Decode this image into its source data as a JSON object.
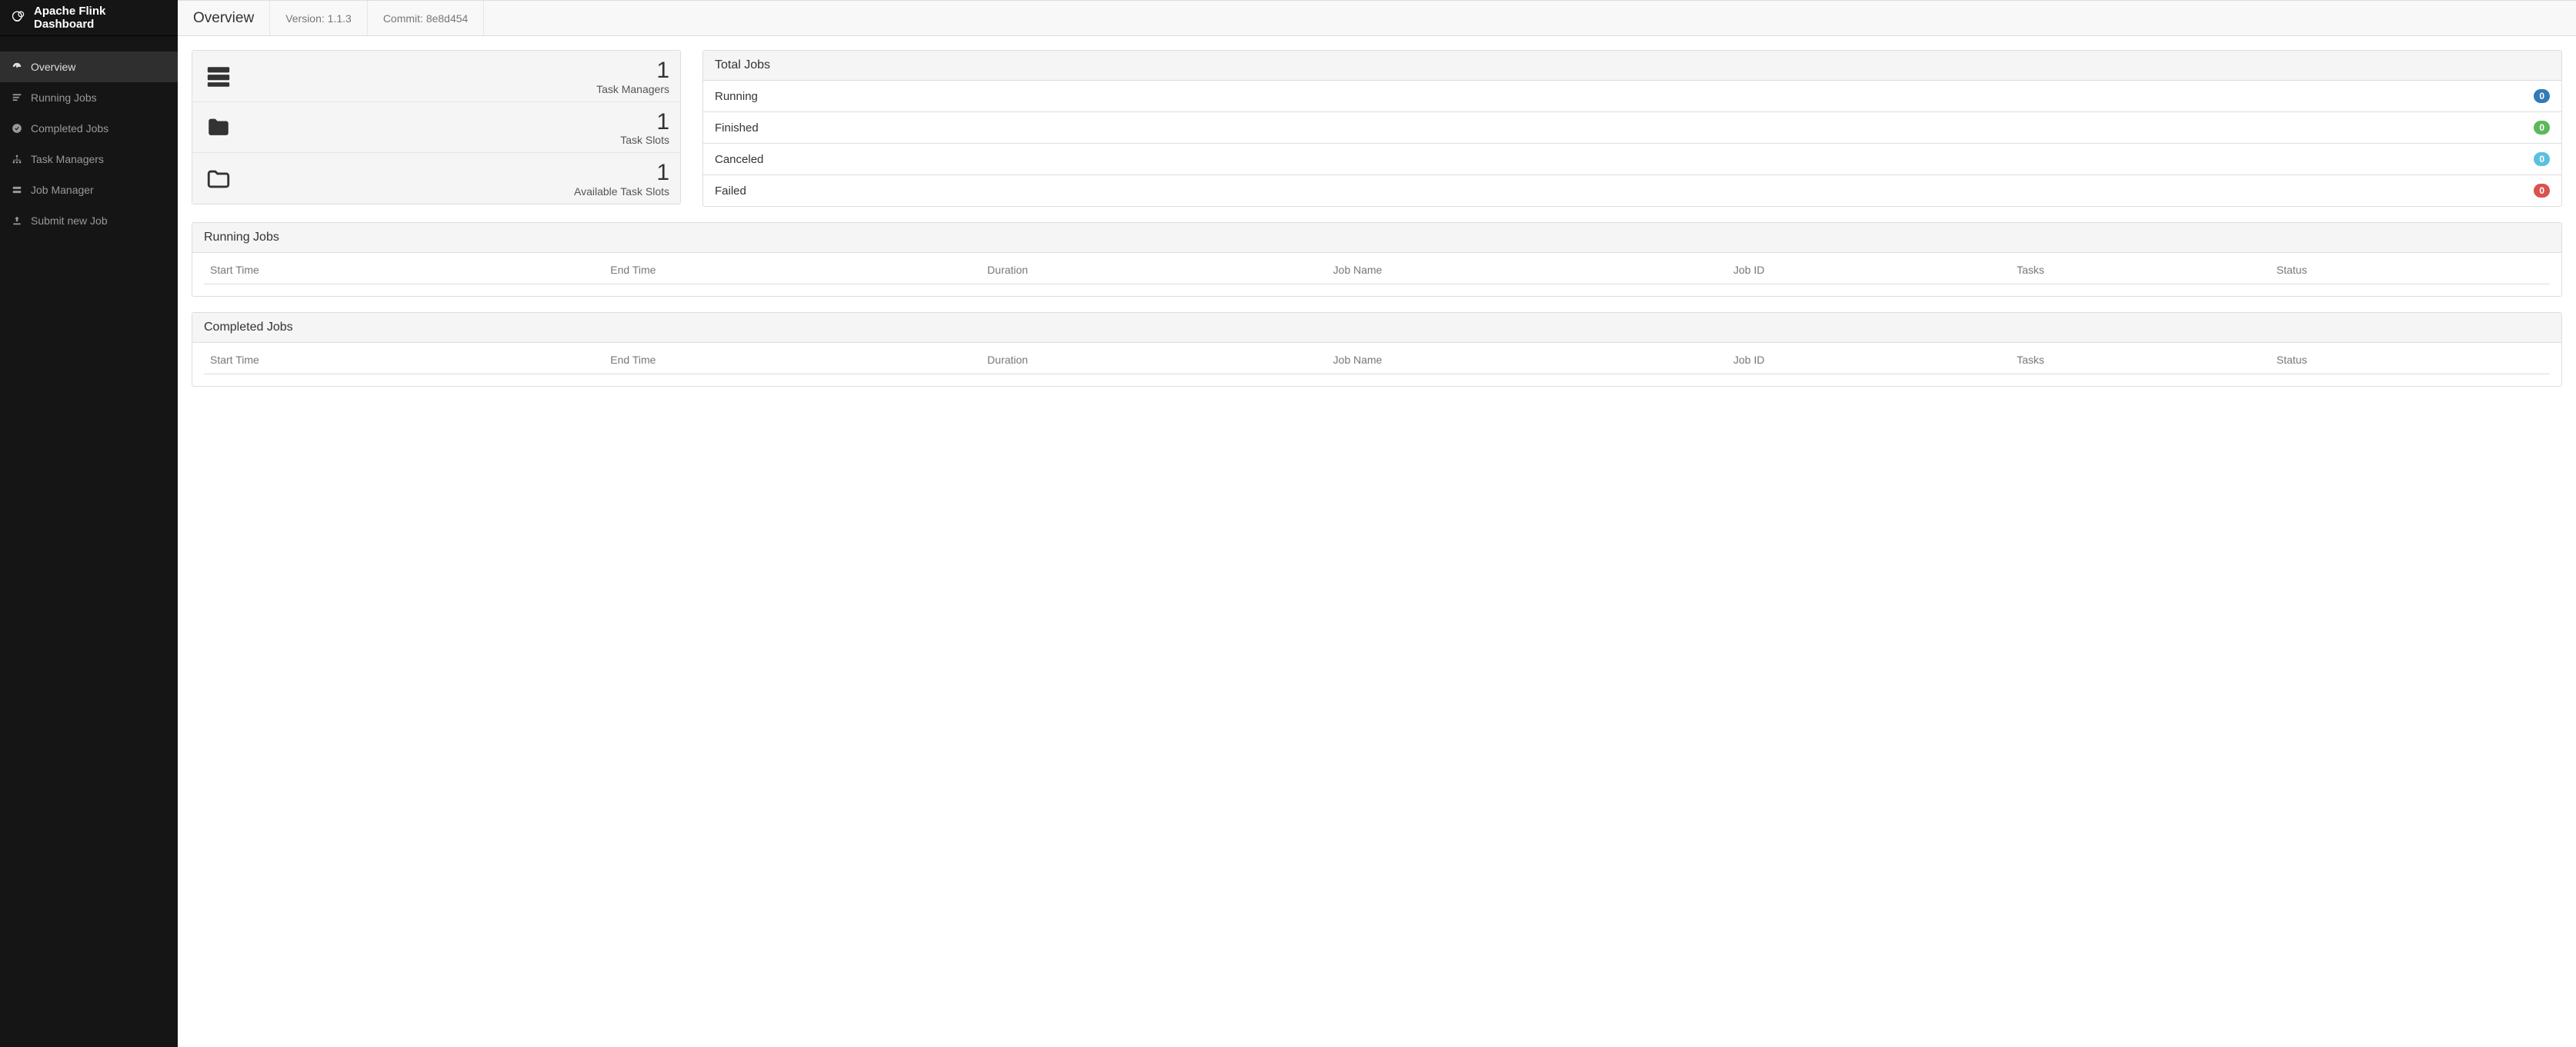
{
  "brand": "Apache Flink Dashboard",
  "sidebar": {
    "items": [
      {
        "label": "Overview"
      },
      {
        "label": "Running Jobs"
      },
      {
        "label": "Completed Jobs"
      },
      {
        "label": "Task Managers"
      },
      {
        "label": "Job Manager"
      },
      {
        "label": "Submit new Job"
      }
    ]
  },
  "topbar": {
    "title": "Overview",
    "version": "Version: 1.1.3",
    "commit": "Commit: 8e8d454"
  },
  "stats": {
    "task_managers": {
      "value": "1",
      "label": "Task Managers"
    },
    "task_slots": {
      "value": "1",
      "label": "Task Slots"
    },
    "available_task_slots": {
      "value": "1",
      "label": "Available Task Slots"
    }
  },
  "total_jobs": {
    "heading": "Total Jobs",
    "rows": [
      {
        "label": "Running",
        "count": "0",
        "color": "primary"
      },
      {
        "label": "Finished",
        "count": "0",
        "color": "success"
      },
      {
        "label": "Canceled",
        "count": "0",
        "color": "info"
      },
      {
        "label": "Failed",
        "count": "0",
        "color": "danger"
      }
    ]
  },
  "running_jobs": {
    "heading": "Running Jobs",
    "columns": [
      "Start Time",
      "End Time",
      "Duration",
      "Job Name",
      "Job ID",
      "Tasks",
      "Status"
    ],
    "rows": []
  },
  "completed_jobs": {
    "heading": "Completed Jobs",
    "columns": [
      "Start Time",
      "End Time",
      "Duration",
      "Job Name",
      "Job ID",
      "Tasks",
      "Status"
    ],
    "rows": []
  }
}
